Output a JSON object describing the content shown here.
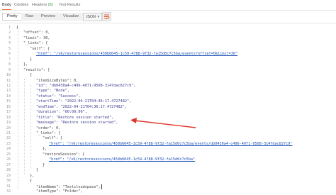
{
  "response_tabs": {
    "body": "Body",
    "cookies": "Cookies",
    "headers": "Headers",
    "headers_count": "(8)",
    "test_results": "Test Results"
  },
  "toolbar": {
    "pretty": "Pretty",
    "raw": "Raw",
    "preview": "Preview",
    "visualize": "Visualize",
    "format": "JSON",
    "wrap_icon": "wrap-lines-icon"
  },
  "code_lines": [
    {
      "n": "1",
      "text": "{"
    },
    {
      "n": "2",
      "text": "\"offset\": 0,"
    },
    {
      "n": "3",
      "text": "\"limit\": 30,"
    },
    {
      "n": "4",
      "text": "\"_links\": {"
    },
    {
      "n": "5",
      "text": "\"self\": {"
    },
    {
      "n": "6",
      "text": "\"href\": \"/v6/restoresessions/450b6045-1c59-4788-9f32-fa15d0c7c5ba/events?offset=0&limit=30\""
    },
    {
      "n": "7",
      "text": "}"
    },
    {
      "n": "8",
      "text": "},"
    },
    {
      "n": "9",
      "text": "\"results\": ["
    },
    {
      "n": "10",
      "text": "{"
    },
    {
      "n": "11",
      "text": "\"itemSizeBytes\": 0,"
    },
    {
      "n": "12",
      "text": "\"id\": \"db0430a4-c496-4071-9508-3147dac827c9\","
    },
    {
      "n": "13",
      "text": "\"type\": \"None\","
    },
    {
      "n": "14",
      "text": "\"status\": \"Success\","
    },
    {
      "n": "15",
      "text": "\"startTime\": \"2022-04-21T04:36:17.4727482\","
    },
    {
      "n": "16",
      "text": "\"endTime\": \"2022-04-21T04:36:17.4727482\","
    },
    {
      "n": "17",
      "text": "\"duration\": \"00:00:00\","
    },
    {
      "n": "18",
      "text": "\"title\": \"Restore session started\","
    },
    {
      "n": "19",
      "text": "\"message\": \"Restore session started\","
    },
    {
      "n": "20",
      "text": "\"order\": 0,"
    },
    {
      "n": "21",
      "text": "\"_links\": {"
    },
    {
      "n": "22",
      "text": "\"self\": {"
    },
    {
      "n": "23",
      "text": "\"href\": \"/v6/restoresessions/450b6045-1c59-4788-9f32-fa15d0c7c5ba/events/db0430a4-c496-4071-9508-3147dac827c9\""
    },
    {
      "n": "24",
      "text": "},"
    },
    {
      "n": "25",
      "text": "\"restoreSession\": {"
    },
    {
      "n": "26",
      "text": "\"href\": \"/v6/restoresessions/450b6045-1c59-4788-9f32-fa15d0c7c5ba\""
    },
    {
      "n": "27",
      "text": "}"
    },
    {
      "n": "28",
      "text": "}"
    },
    {
      "n": "29",
      "text": "},"
    },
    {
      "n": "30",
      "text": "{"
    },
    {
      "n": "31",
      "text": "\"itemName\": \"Testcloudspace\","
    },
    {
      "n": "32",
      "text": "\"itemType\": \"Folder\","
    }
  ],
  "colors": {
    "accent_tab": "#f26b3a",
    "headers_count": "#3aa14b",
    "annotation_arrow": "#e0332b"
  }
}
